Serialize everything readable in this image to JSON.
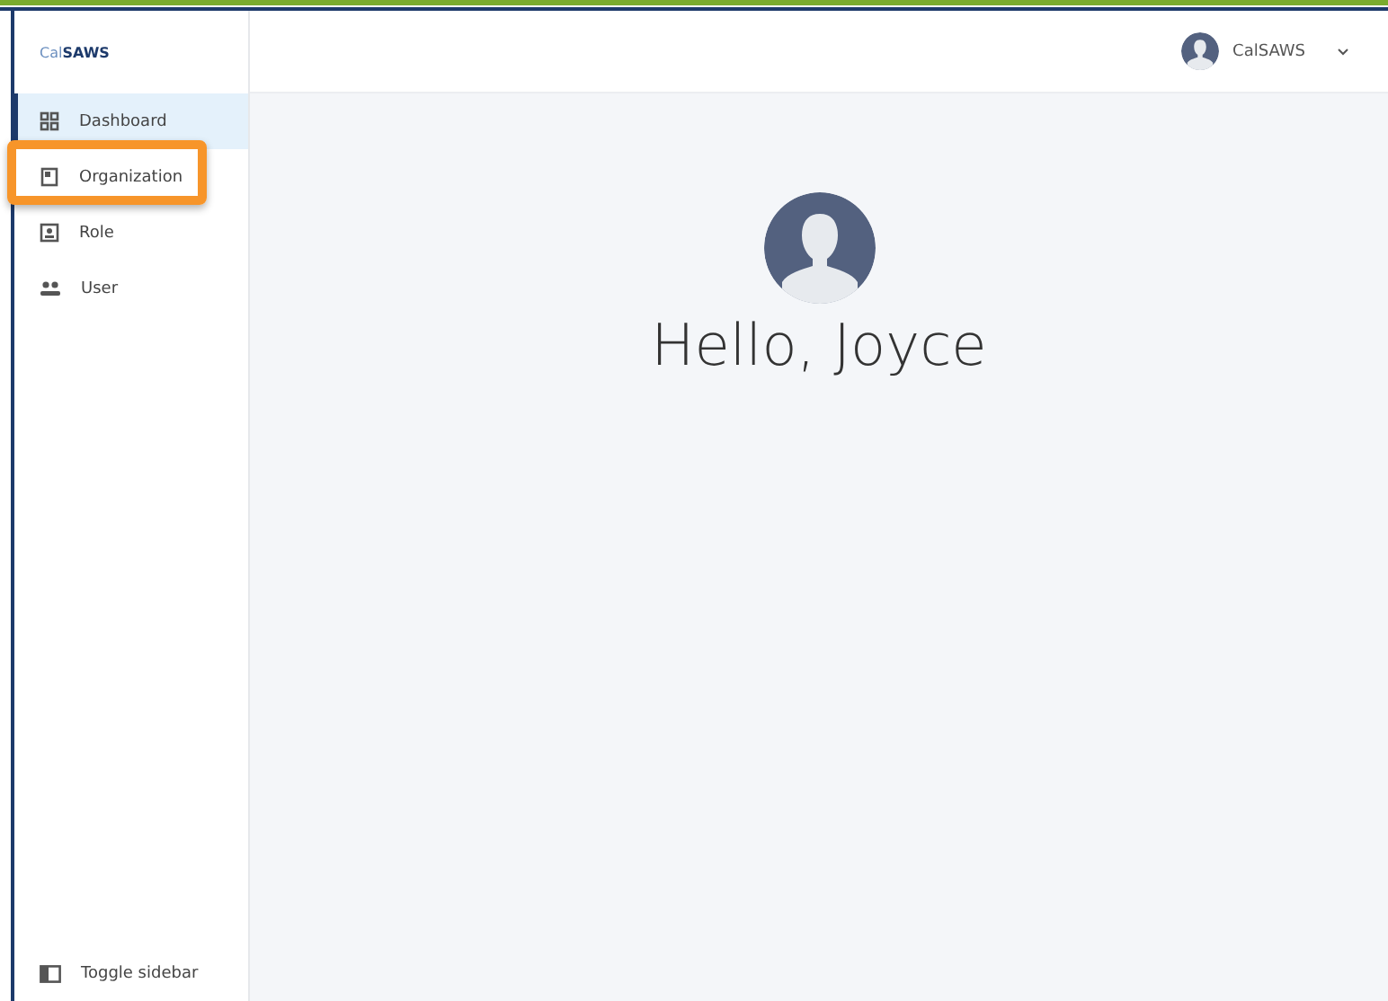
{
  "sidebar": {
    "logo": "Cal**SAWS**",
    "items": [
      {
        "label": "Dashboard",
        "selected": true,
        "highlighted": false
      },
      {
        "label": "Organization",
        "selected": false,
        "highlighted": true
      },
      {
        "label": "Role",
        "selected": false,
        "highlighted": false
      },
      {
        "label": "User",
        "selected": false,
        "highlighted": false
      }
    ],
    "toggle": "Toggle sidebar"
  },
  "header": {
    "user_name": "CalSAWS"
  },
  "main": {
    "greeting": "Hello, Joyce"
  }
}
